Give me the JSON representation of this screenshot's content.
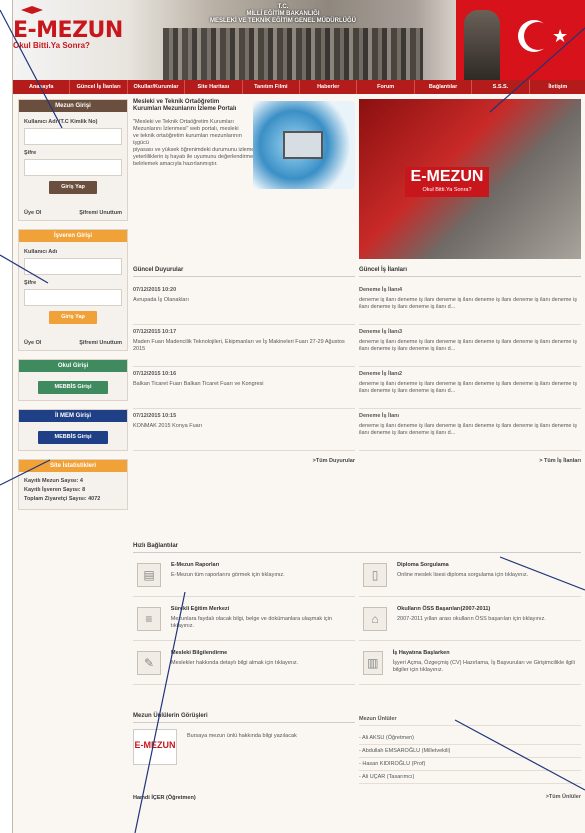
{
  "header": {
    "logo": "E-MEZUN",
    "slogan": "Okul Bitti.Ya Sonra?",
    "ministry_line1": "T.C.",
    "ministry_line2": "MİLLİ EĞİTİM BAKANLIĞI",
    "ministry_line3": "MESLEKİ VE TEKNİK EĞİTİM GENEL MÜDÜRLÜĞÜ"
  },
  "nav": [
    "Anasayfa",
    "Güncel İş İlanları",
    "Okullar/Kurumlar",
    "Site Haritası",
    "Tanıtım Filmi",
    "Haberler",
    "Forum",
    "Bağlantılar",
    "S.S.S.",
    "İletişim"
  ],
  "sidebar": {
    "mezun": {
      "title": "Mezun Girişi",
      "user_label": "Kullanıcı Adı (T.C Kimlik No)",
      "pass_label": "Şifre",
      "button": "Giriş Yap",
      "register": "Üye Ol",
      "forgot": "Şifremi Unuttum"
    },
    "isveren": {
      "title": "İşveren Girişi",
      "user_label": "Kullanıcı Adı",
      "pass_label": "Şifre",
      "button": "Giriş Yap",
      "register": "Üye Ol",
      "forgot": "Şifremi Unuttum"
    },
    "okul": {
      "title": "Okul Girişi",
      "button": "MEBBİS Girişi"
    },
    "ilmem": {
      "title": "İl MEM Girişi",
      "button": "MEBBİS Girişi"
    },
    "stats": {
      "title": "Site İstatistikleri",
      "line1": "Kayıtlı Mezun Sayısı: 4",
      "line2": "Kayıtlı İşveren Sayısı: 8",
      "line3": "Toplam Ziyaretçi Sayısı: 4072"
    }
  },
  "intro": {
    "title": "Mesleki ve Teknik Ortaöğretim Kurumları Mezunlarını İzleme Portalı",
    "para1": "\"Mesleki ve Teknik Ortaöğretim Kurumları Mezunlarını İzlenmesi\" web portalı, mesleki ve teknik ortaöğretim kurumları mezunlarının işgücü",
    "para2": "piyasası ve yüksek öğrenimdeki durumunu izlemek, eğitime ilişkin kazandıkları mesleki yeterliliklerin iş hayatı ile uyumunu değerlendirmek, sistemin güçlü ve zayıf yönlerini belirlemek amacıyla hazırlanmıştır."
  },
  "promo": {
    "logo": "E-MEZUN",
    "slogan": "Okul Bitti.Ya Sonra?"
  },
  "announcements": {
    "title": "Güncel Duyurular",
    "items": [
      {
        "date": "07/12/2015 10:20",
        "text": "Avrupada İş Olanakları"
      },
      {
        "date": "07/12/2015 10:17",
        "text": "Maden Fuarı Madencilik Teknolojileri, Ekipmanları ve İş Makineleri Fuarı 27-29 Ağustos 2015"
      },
      {
        "date": "07/12/2015 10:16",
        "text": "Balkan Ticaret Fuarı Balkan Ticaret Fuarı ve Kongresi"
      },
      {
        "date": "07/12/2015 10:15",
        "text": "KONMAK 2015 Konya Fuarı"
      }
    ],
    "more": ">Tüm Duyurular"
  },
  "jobs": {
    "title": "Güncel İş İlanları",
    "items": [
      {
        "title": "Deneme İş İlanı4",
        "text": "deneme iş ilanı deneme iş ilanı deneme iş ilanı deneme iş ilanı deneme iş ilanı deneme iş ilanı deneme iş ilanı deneme iş ilanı d..."
      },
      {
        "title": "Deneme İş İlanı3",
        "text": "deneme iş ilanı deneme iş ilanı deneme iş ilanı deneme iş ilanı deneme iş ilanı deneme iş ilanı deneme iş ilanı deneme iş ilanı d..."
      },
      {
        "title": "Deneme İş İlanı2",
        "text": "deneme iş ilanı deneme iş ilanı deneme iş ilanı deneme iş ilanı deneme iş ilanı deneme iş ilanı deneme iş ilanı deneme iş ilanı d..."
      },
      {
        "title": "Deneme İş İlanı",
        "text": "deneme iş ilanı deneme iş ilanı deneme iş ilanı deneme iş ilanı deneme iş ilanı deneme iş ilanı deneme iş ilanı deneme iş ilanı d..."
      }
    ],
    "more": "> Tüm İş İlanları"
  },
  "quick": {
    "title": "Hızlı Bağlantılar",
    "items": [
      {
        "title": "E-Mezun Raporları",
        "desc": "E-Mezun tüm raporlarını görmek için tıklayınız."
      },
      {
        "title": "Diploma Sorgulama",
        "desc": "Online meslek lisesi diploma sorgulama için tıklayınız."
      },
      {
        "title": "Sürekli Eğitim Merkezi",
        "desc": "Mezunlara faydalı olacak bilgi, belge ve dokümanlara ulaşmak için tıklayınız."
      },
      {
        "title": "Okulların ÖSS Başarıları(2007-2011)",
        "desc": "2007-2011 yılları arası okulların ÖSS başarıları için tıklayınız."
      },
      {
        "title": "Mesleki Bilgilendirme",
        "desc": "Meslekler hakkında detaylı bilgi almak için tıklayınız."
      },
      {
        "title": "İş Hayatına Başlarken",
        "desc": "İşyeri Açma, Özgeçmiş (CV) Hazırlama, İş Başvuruları ve Girişimcilikle ilgili bilgiler için tıklayınız."
      }
    ]
  },
  "opinions": {
    "title": "Mezun Ünlülerin Görüşleri",
    "logo": "E-MEZUN",
    "text": "Bursaya mezun ünlü hakkında bilgi yazılacak",
    "name": "Hamdi İÇER (Öğretmen)"
  },
  "famous": {
    "title": "Mezun Ünlüler",
    "items": [
      "- Ali AKSU (Öğretmen)",
      "- Abdullah EMSAROĞLU (Milletvekili)",
      "- Hasan KIDIROĞLU (Prof)",
      "- Ali UÇAR (Tasarımcı)"
    ],
    "more": ">Tüm Ünlüler"
  },
  "colors": {
    "red": "#b41c1c",
    "brown": "#6b4f3e",
    "orange": "#f0a238",
    "green": "#3f8a5e",
    "navy": "#1f3f86",
    "callout": "#20357a"
  }
}
